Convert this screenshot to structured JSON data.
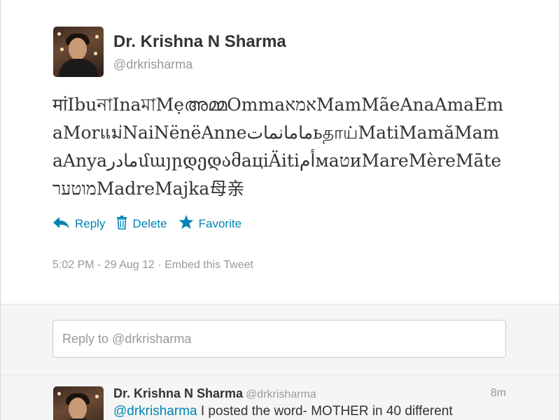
{
  "tweet": {
    "author_name": "Dr. Krishna N Sharma",
    "author_handle": "@drkrisharma",
    "text": "मांIbuনাInaমাMẹഅമ്മOmmaאמאMamMãeAnaAmaEmaMorแม่NaiNënëAnneمامانماتьதாய்MatiMamăMamaAnyaمادرմայրდედამаціÄitiأمмаטиMareMèreMāteמוטערMadreMajka母亲",
    "timestamp": "5:02 PM - 29 Aug 12",
    "separator": "·",
    "embed_label": "Embed this Tweet"
  },
  "actions": {
    "reply": "Reply",
    "delete": "Delete",
    "favorite": "Favorite"
  },
  "reply_box": {
    "placeholder": "Reply to @drkrisharma"
  },
  "reply_tweet": {
    "author_name": "Dr. Krishna N Sharma",
    "author_handle": "@drkrisharma",
    "time": "8m",
    "mention": "@drkrisharma",
    "text": " I posted the word- MOTHER in 40 different"
  },
  "colors": {
    "link": "#0084b4",
    "text": "#333333",
    "muted": "#999999"
  }
}
